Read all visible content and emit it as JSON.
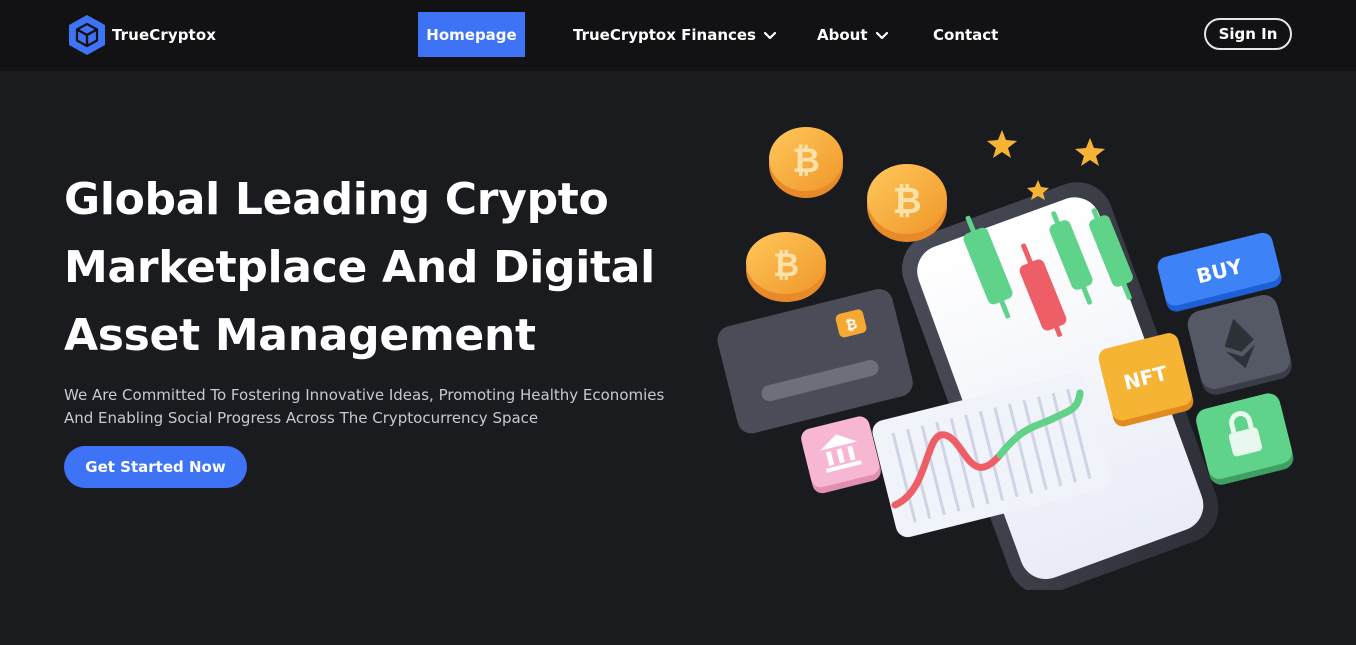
{
  "brand": {
    "name": "TrueCryptox",
    "icon": "cube-logo-icon",
    "accent": "#3d73f4"
  },
  "nav": {
    "items": [
      {
        "label": "Homepage",
        "active": true
      },
      {
        "label": "TrueCryptox Finances",
        "dropdown": true
      },
      {
        "label": "About",
        "dropdown": true
      },
      {
        "label": "Contact"
      }
    ],
    "signin": "Sign In"
  },
  "hero": {
    "title_lines": [
      "Global Leading Crypto",
      "Marketplace And Digital",
      "Asset Management"
    ],
    "subtitle_lines": [
      "We Are Committed To Fostering Innovative Ideas, Promoting Healthy Economies",
      "And Enabling Social Progress Across The Cryptocurrency Space"
    ],
    "cta": "Get Started Now"
  },
  "illustration": {
    "buy_badge": "BUY",
    "nft_badge": "NFT",
    "icons": [
      "bitcoin-coin-icon",
      "phone-icon",
      "credit-card-icon",
      "ethereum-icon",
      "lock-icon",
      "bank-icon",
      "star-icon",
      "candlestick-icon"
    ]
  }
}
